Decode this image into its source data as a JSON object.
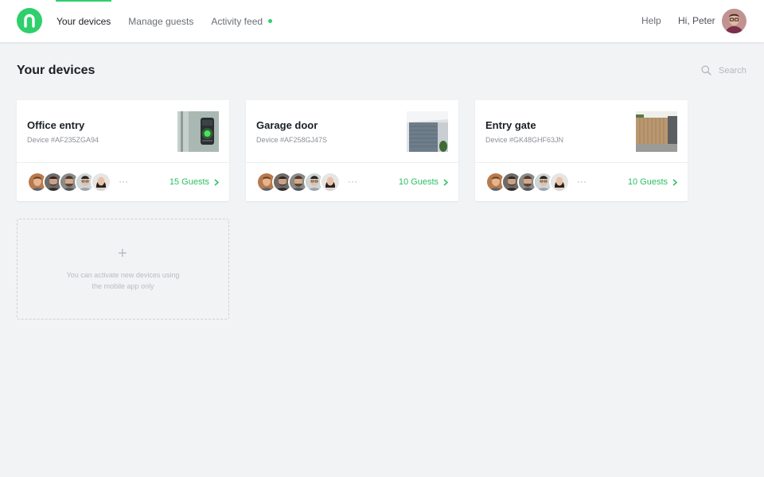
{
  "header": {
    "nav": [
      {
        "label": "Your devices"
      },
      {
        "label": "Manage guests"
      },
      {
        "label": "Activity feed"
      }
    ],
    "help": "Help",
    "greeting": "Hi, Peter"
  },
  "page": {
    "title": "Your devices",
    "search_placeholder": "Search"
  },
  "devices": [
    {
      "name": "Office entry",
      "id": "Device #AF235ZGA94",
      "guests": "15 Guests",
      "thumb": "keypad"
    },
    {
      "name": "Garage door",
      "id": "Device #AF258GJ47S",
      "guests": "10 Guests",
      "thumb": "garage"
    },
    {
      "name": "Entry gate",
      "id": "Device #GK48GHF63JN",
      "guests": "10 Guests",
      "thumb": "gate"
    }
  ],
  "more_glyph": "···",
  "add_device": {
    "plus": "+",
    "line1": "You can activate new devices using",
    "line2": "the mobile app only"
  },
  "colors": {
    "accent": "#2fcf6b",
    "link": "#2bbf63",
    "background": "#f2f3f5"
  },
  "icons": [
    "logo-icon",
    "search-icon",
    "chevron-right-icon",
    "plus-icon"
  ]
}
